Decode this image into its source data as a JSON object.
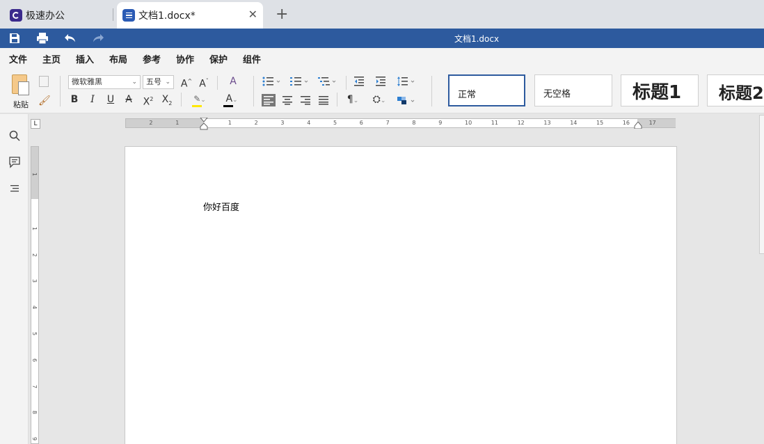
{
  "tabs": [
    {
      "label": "极速办公"
    },
    {
      "label": "文档1.docx*"
    }
  ],
  "title_bar": {
    "document_title": "文档1.docx"
  },
  "menu": {
    "items": [
      "文件",
      "主页",
      "插入",
      "布局",
      "参考",
      "协作",
      "保护",
      "组件"
    ],
    "active": "主页"
  },
  "ribbon": {
    "paste_label": "粘贴",
    "font_name": "微软雅黑",
    "font_size": "五号",
    "styles": [
      "正常",
      "无空格",
      "标题1",
      "标题2"
    ]
  },
  "ruler": {
    "h_numbers": [
      "2",
      "1",
      "1",
      "2",
      "3",
      "4",
      "5",
      "6",
      "7",
      "8",
      "9",
      "10",
      "11",
      "12",
      "13",
      "14",
      "15",
      "16",
      "17"
    ],
    "v_numbers": [
      "1",
      "1",
      "2",
      "3",
      "4",
      "5",
      "6",
      "7",
      "8",
      "9"
    ]
  },
  "document": {
    "body_text": "你好百度"
  },
  "colors": {
    "accent": "#2d5a9e",
    "font_color_bar": "#000000",
    "highlight_bar": "#ffe800"
  }
}
